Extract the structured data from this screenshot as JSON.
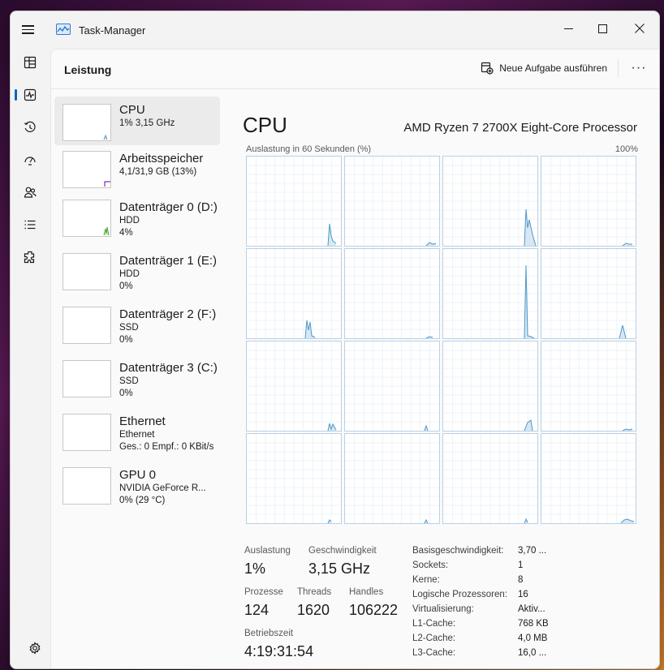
{
  "app": {
    "title": "Task-Manager"
  },
  "page": {
    "title": "Leistung"
  },
  "toolbar": {
    "run_task_label": "Neue Aufgabe ausführen",
    "more_label": "···"
  },
  "nav": {
    "items": [
      {
        "name": "processes",
        "icon": "processes-icon"
      },
      {
        "name": "performance",
        "icon": "performance-icon",
        "active": true
      },
      {
        "name": "app-history",
        "icon": "history-icon"
      },
      {
        "name": "startup-apps",
        "icon": "startup-icon"
      },
      {
        "name": "users",
        "icon": "users-icon"
      },
      {
        "name": "details",
        "icon": "details-icon"
      },
      {
        "name": "services",
        "icon": "services-icon"
      }
    ],
    "settings_icon": "gear-icon"
  },
  "resources": [
    {
      "name": "CPU",
      "sub1": "1% 3,15 GHz",
      "sub2": "",
      "selected": true
    },
    {
      "name": "Arbeitsspeicher",
      "sub1": "4,1/31,9 GB (13%)",
      "sub2": ""
    },
    {
      "name": "Datenträger 0 (D:)",
      "sub1": "HDD",
      "sub2": "4%"
    },
    {
      "name": "Datenträger 1 (E:)",
      "sub1": "HDD",
      "sub2": "0%"
    },
    {
      "name": "Datenträger 2 (F:)",
      "sub1": "SSD",
      "sub2": "0%"
    },
    {
      "name": "Datenträger 3 (C:)",
      "sub1": "SSD",
      "sub2": "0%"
    },
    {
      "name": "Ethernet",
      "sub1": "Ethernet",
      "sub2": "Ges.: 0 Empf.: 0 KBit/s"
    },
    {
      "name": "GPU 0",
      "sub1": "NVIDIA GeForce R...",
      "sub2": "0% (29 °C)"
    }
  ],
  "detail": {
    "title": "CPU",
    "model": "AMD Ryzen 7 2700X Eight-Core Processor",
    "graph_label": "Auslastung in 60 Sekunden (%)",
    "graph_max": "100%",
    "accent_color": "#4f97c6",
    "core_count": 16
  },
  "stats": {
    "utilization_label": "Auslastung",
    "utilization_value": "1%",
    "speed_label": "Geschwindigkeit",
    "speed_value": "3,15 GHz",
    "processes_label": "Prozesse",
    "processes_value": "124",
    "threads_label": "Threads",
    "threads_value": "1620",
    "handles_label": "Handles",
    "handles_value": "106222",
    "uptime_label": "Betriebszeit",
    "uptime_value": "4:19:31:54"
  },
  "specs": [
    {
      "key": "Basisgeschwindigkeit:",
      "value": "3,70 ..."
    },
    {
      "key": "Sockets:",
      "value": "1"
    },
    {
      "key": "Kerne:",
      "value": "8"
    },
    {
      "key": "Logische Prozessoren:",
      "value": "16"
    },
    {
      "key": "Virtualisierung:",
      "value": "Aktiv..."
    },
    {
      "key": "L1-Cache:",
      "value": "768 KB"
    },
    {
      "key": "L2-Cache:",
      "value": "4,0 MB"
    },
    {
      "key": "L3-Cache:",
      "value": "16,0 ..."
    }
  ]
}
